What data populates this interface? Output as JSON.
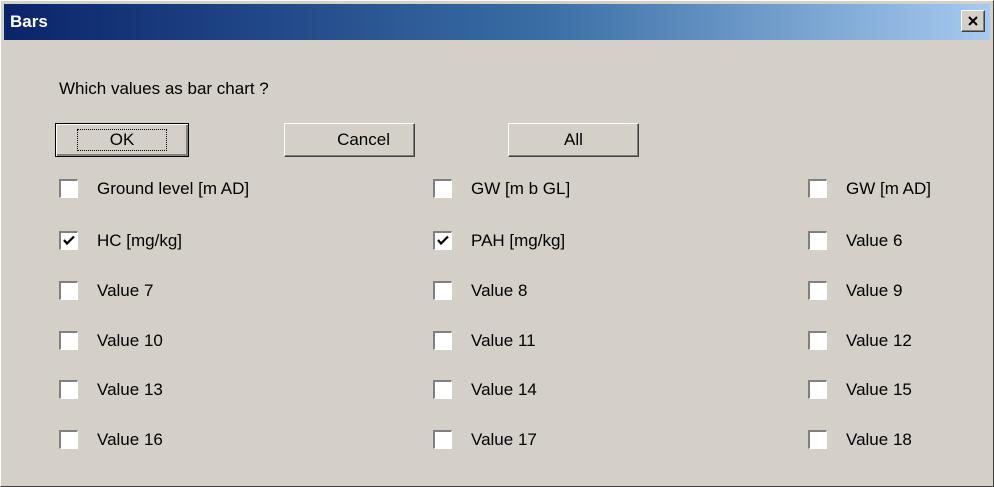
{
  "window": {
    "title": "Bars"
  },
  "prompt": "Which values as bar chart ?",
  "buttons": {
    "ok": "OK",
    "cancel": "Cancel",
    "all": "All"
  },
  "checkboxes": [
    {
      "label": "Ground level [m AD]",
      "checked": false
    },
    {
      "label": "GW [m b GL]",
      "checked": false
    },
    {
      "label": "GW [m AD]",
      "checked": false
    },
    {
      "label": "HC [mg/kg]",
      "checked": true
    },
    {
      "label": "PAH [mg/kg]",
      "checked": true
    },
    {
      "label": "Value 6",
      "checked": false
    },
    {
      "label": "Value 7",
      "checked": false
    },
    {
      "label": "Value 8",
      "checked": false
    },
    {
      "label": "Value 9",
      "checked": false
    },
    {
      "label": "Value 10",
      "checked": false
    },
    {
      "label": "Value 11",
      "checked": false
    },
    {
      "label": "Value 12",
      "checked": false
    },
    {
      "label": "Value 13",
      "checked": false
    },
    {
      "label": "Value 14",
      "checked": false
    },
    {
      "label": "Value 15",
      "checked": false
    },
    {
      "label": "Value 16",
      "checked": false
    },
    {
      "label": "Value 17",
      "checked": false
    },
    {
      "label": "Value 18",
      "checked": false
    }
  ],
  "colors": {
    "dialog_bg": "#d4d0c8",
    "titlebar_start": "#0a246a",
    "titlebar_end": "#a6caf0"
  }
}
